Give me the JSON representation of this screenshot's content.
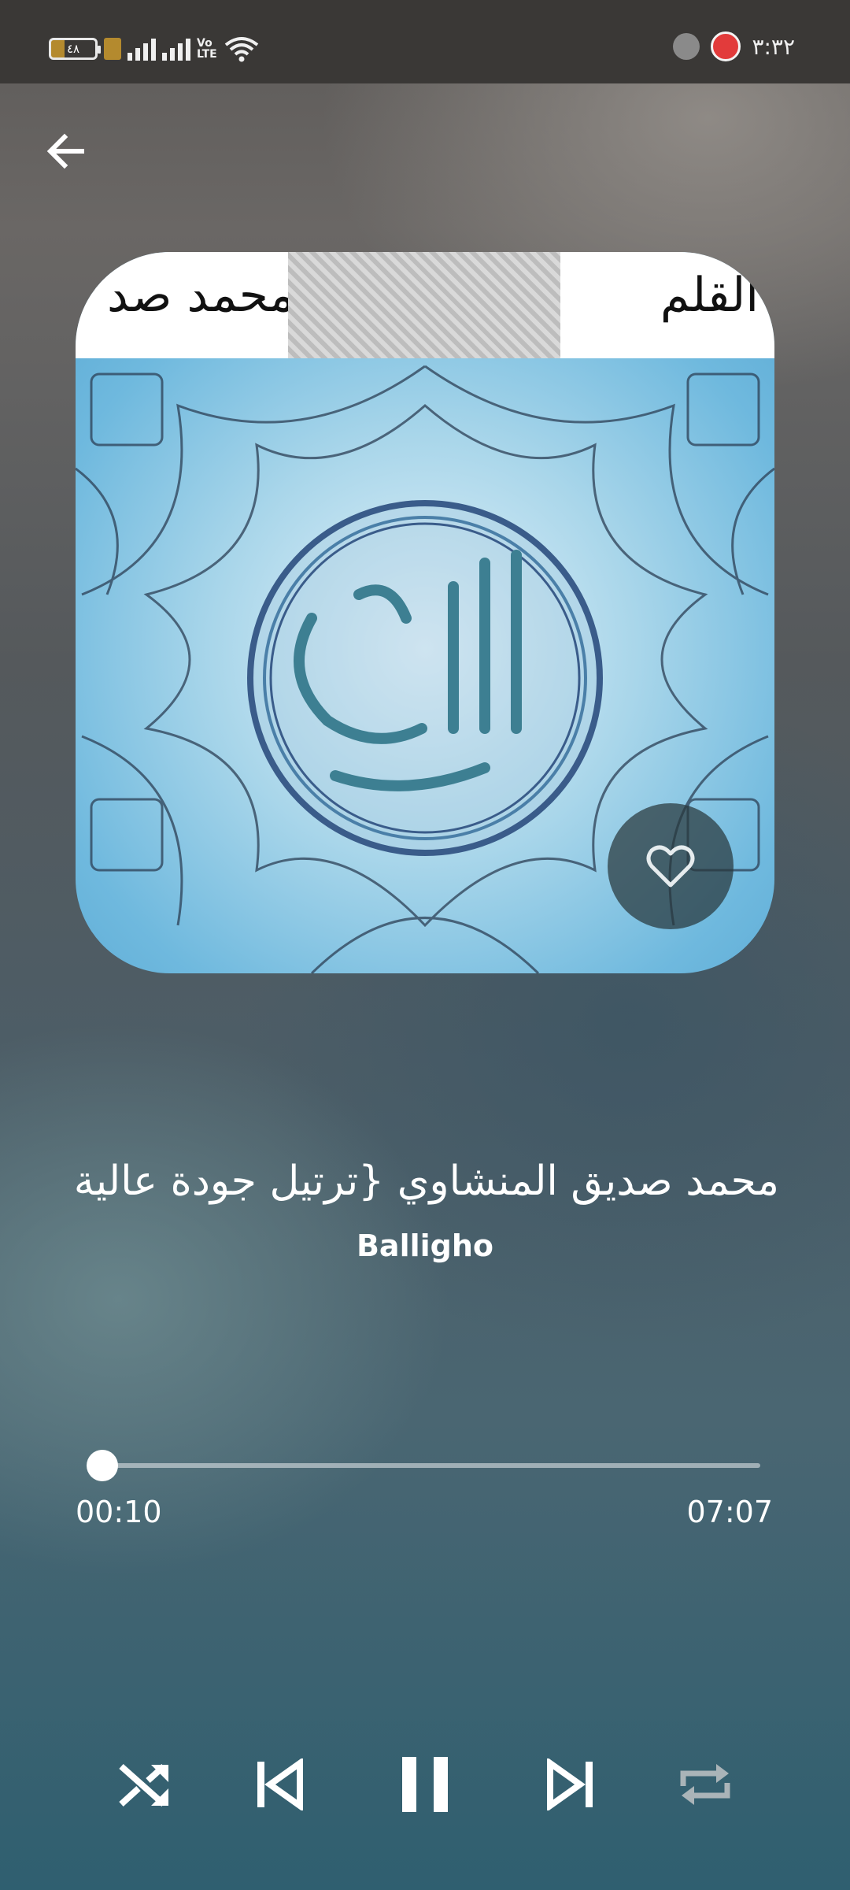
{
  "status_bar": {
    "battery_level": "٤٨",
    "volte_top": "Vo",
    "volte_bottom": "LTE",
    "clock": "٣:٣٢"
  },
  "navigation": {
    "back_icon": "arrow-left-icon"
  },
  "album_art": {
    "banner_left_text": "محمد صد",
    "banner_right_text": "القلم",
    "favorite_icon": "heart-outline-icon"
  },
  "track": {
    "title": "محمد صديق المنشاوي {ترتيل جودة عالية}",
    "artist": "Balligho"
  },
  "progress": {
    "elapsed": "00:10",
    "total": "07:07",
    "fraction": 0.0
  },
  "controls": {
    "shuffle_icon": "shuffle-icon",
    "previous_icon": "skip-previous-icon",
    "play_pause_icon": "pause-icon",
    "next_icon": "skip-next-icon",
    "repeat_icon": "repeat-icon"
  },
  "colors": {
    "accent": "#ffffff",
    "repeat_inactive": "#aab4b8"
  }
}
